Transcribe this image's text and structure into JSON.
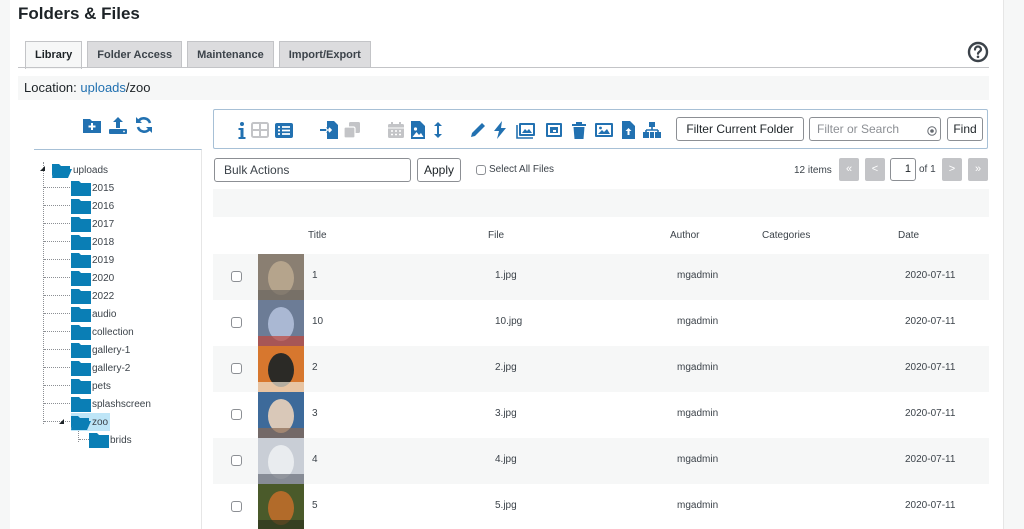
{
  "page": {
    "title": "Folders & Files",
    "tabs": [
      {
        "label": "Library",
        "active": true
      },
      {
        "label": "Folder Access",
        "active": false
      },
      {
        "label": "Maintenance",
        "active": false
      },
      {
        "label": "Import/Export",
        "active": false
      }
    ],
    "help_icon": "question-circle-icon"
  },
  "location": {
    "label": "Location: ",
    "link": "uploads",
    "rest": "/zoo"
  },
  "sidebar": {
    "icons": [
      "folder-plus-icon",
      "upload-icon",
      "refresh-icon"
    ],
    "tree": {
      "root": "uploads",
      "children": [
        "2015",
        "2016",
        "2017",
        "2018",
        "2019",
        "2020",
        "2022",
        "audio",
        "collection",
        "gallery-1",
        "gallery-2",
        "pets",
        "splashscreen",
        "zoo"
      ],
      "selected": "zoo",
      "selected_children": [
        "brids"
      ]
    }
  },
  "toolbar": {
    "icons": [
      "info-icon",
      "grid-view-icon",
      "list-view-icon",
      "move-file-icon",
      "copy-icon",
      "calendar-icon",
      "image-file-icon",
      "sort-icon",
      "edit-icon",
      "bolt-icon",
      "gallery-icon",
      "thumbnail-icon",
      "trash-icon",
      "image-icon",
      "upload-file-icon",
      "sitemap-icon"
    ],
    "filter_button": "Filter Current Folder",
    "search_placeholder": "Filter or Search",
    "search_value": "",
    "find_button": "Find"
  },
  "actions": {
    "bulk_select": "Bulk Actions",
    "apply": "Apply",
    "select_all": "Select All Files",
    "item_count": "12 items",
    "pagination": {
      "first": "«",
      "prev": "<",
      "current": "1",
      "of": "of 1",
      "next": ">",
      "last": "»"
    }
  },
  "table": {
    "columns": [
      "Title",
      "File",
      "Author",
      "Categories",
      "Date"
    ],
    "rows": [
      {
        "title": "1",
        "file": "1.jpg",
        "author": "mgadmin",
        "categories": "",
        "date": "2020-07-11",
        "thumb": "kangaroo"
      },
      {
        "title": "10",
        "file": "10.jpg",
        "author": "mgadmin",
        "categories": "",
        "date": "2020-07-11",
        "thumb": "parakeet"
      },
      {
        "title": "2",
        "file": "2.jpg",
        "author": "mgadmin",
        "categories": "",
        "date": "2020-07-11",
        "thumb": "tigers"
      },
      {
        "title": "3",
        "file": "3.jpg",
        "author": "mgadmin",
        "categories": "",
        "date": "2020-07-11",
        "thumb": "white-cub"
      },
      {
        "title": "4",
        "file": "4.jpg",
        "author": "mgadmin",
        "categories": "",
        "date": "2020-07-11",
        "thumb": "snow-leopard"
      },
      {
        "title": "5",
        "file": "5.jpg",
        "author": "mgadmin",
        "categories": "",
        "date": "2020-07-11",
        "thumb": "tiger-forest"
      }
    ]
  },
  "colors": {
    "accent": "#2271b1",
    "folder": "#0a7eb5",
    "selected_folder_bg": "#bee5f7",
    "disabled_icon": "#c3c4c7"
  }
}
